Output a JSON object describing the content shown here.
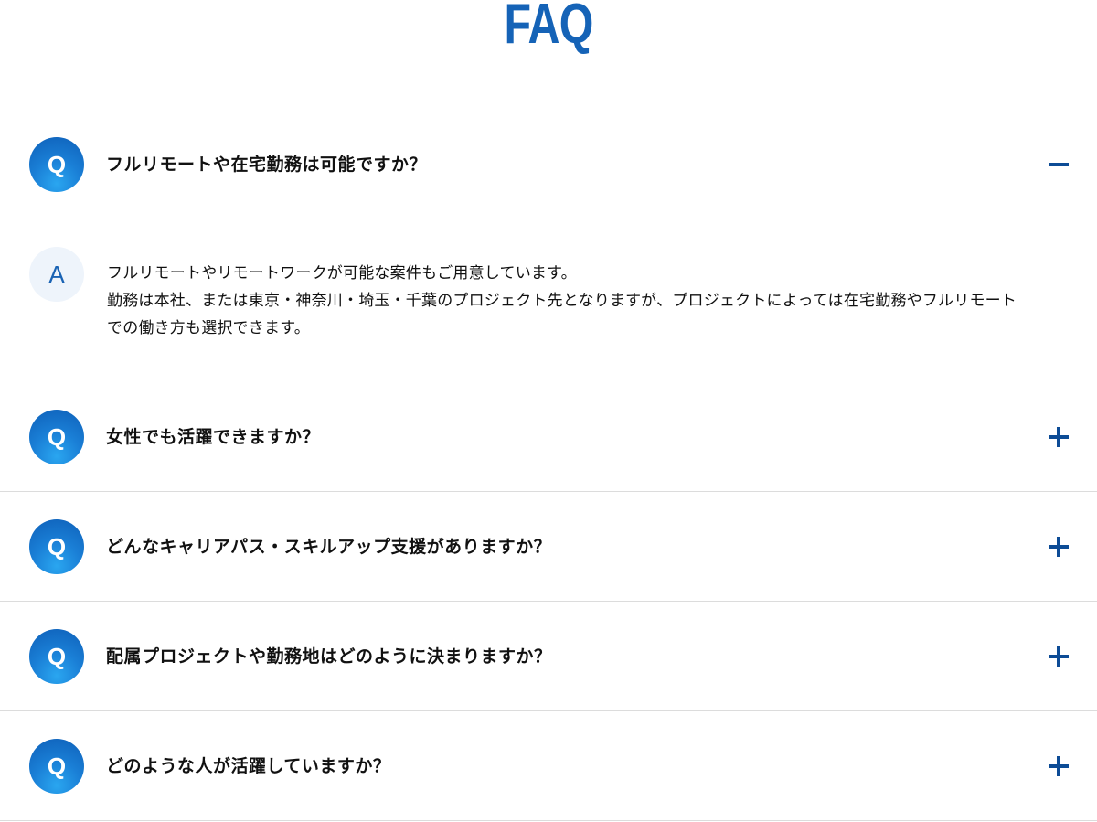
{
  "header": {
    "title": "FAQ"
  },
  "badges": {
    "question": "Q",
    "answer": "A"
  },
  "faq": {
    "items": [
      {
        "question": "フルリモートや在宅勤務は可能ですか？",
        "expanded": true,
        "answer_line1": "フルリモートやリモートワークが可能な案件もご用意しています。",
        "answer_line2": " 勤務は本社、または東京・神奈川・埼玉・千葉のプロジェクト先となりますが、プロジェクトによっては在宅勤務やフルリモートでの働き方も選択できます。"
      },
      {
        "question": "女性でも活躍できますか？",
        "expanded": false
      },
      {
        "question": "どんなキャリアパス・スキルアップ支援がありますか？",
        "expanded": false
      },
      {
        "question": "配属プロジェクトや勤務地はどのように決まりますか？",
        "expanded": false
      },
      {
        "question": "どのような人が活躍していますか？",
        "expanded": false
      }
    ]
  },
  "icons": {
    "collapse": "minus-icon",
    "expand": "plus-icon"
  },
  "colors": {
    "brand": "#1563b7",
    "toggle": "#0d4c96",
    "answer_badge_bg": "#eef4fb",
    "divider": "#dcdcdc"
  }
}
